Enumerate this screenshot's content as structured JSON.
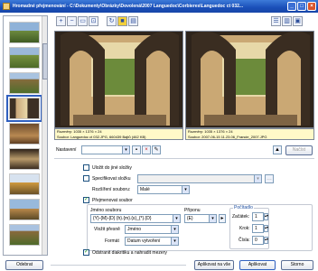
{
  "window": {
    "title": "Hromadné přejmenování - C:\\Dokumenty\\Obrázky\\Dovolená\\2007 Languedoc\\Corbieres\\Languedoc ct 032..."
  },
  "preview": {
    "left_info_line1": "Rozměry: 1035 × 1376 × 24",
    "left_info_line2": "Soubor: Languedoc ct 032.JPG, 660439 Bajtů (462 KB)",
    "right_info_line1": "Rozměry: 1035 × 1376 × 24",
    "right_info_line2": "Soubor: 2007-06-15 11.23.06_Francie_2007.JPG"
  },
  "form": {
    "nastaveni_label": "Nastavení",
    "nastaveni_value": "",
    "nacist_label": "Načíst",
    "opt_ulozit": "Uložit do jiné složky",
    "opt_specifikovat": "Specifikovat složku",
    "rozsir_label": "Rozšíření souboru:",
    "rozsir_value": "Malé",
    "opt_prejmenovat": "Přejmenovat soubor",
    "jmeno_label": "Jméno souboru",
    "jmeno_value": "{Y}-{M}-{D} {h}.{m}.{s}_{*}.{D}",
    "prilozna_label": "Příponu",
    "prilozna_value": "{E}",
    "vlozit_label": "Vložit přesně",
    "vlozit_value": "Jméno",
    "format_label": "Formát",
    "format_value": "Datum vytvoření",
    "opt_odstranit": "Odstranit diakritiku a nahradit mezery",
    "pocitadlo_title": "Počítadlo",
    "zacatek_label": "Začátek:",
    "zacatek_value": "1",
    "krok_label": "Krok:",
    "krok_value": "1",
    "cisla_label": "Čísla:",
    "cisla_value": "0"
  },
  "buttons": {
    "odebrat": "Odebrat",
    "aplikovat_vse": "Aplikovat na vše",
    "aplikovat": "Aplikovat",
    "storno": "Storno"
  },
  "colors": {
    "titlebar": "#1a4fb8",
    "accent": "#2f5fbf",
    "info_bg": "#fff9c8"
  }
}
